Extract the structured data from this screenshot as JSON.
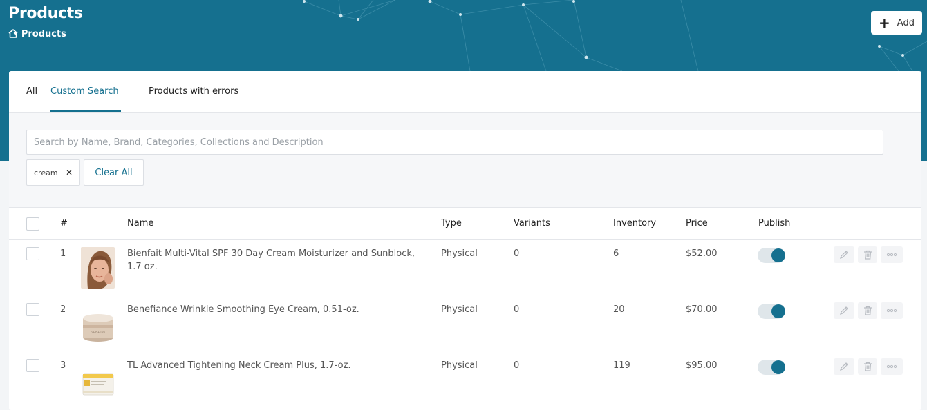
{
  "header": {
    "title": "Products",
    "breadcrumb": "• Products",
    "add_label": "Add",
    "brand_color": "#15708f"
  },
  "tabs": [
    {
      "label": "All",
      "active": false
    },
    {
      "label": "Custom Search",
      "active": true
    },
    {
      "label": "Products with errors",
      "active": false
    }
  ],
  "search": {
    "placeholder": "Search by Name, Brand, Categories, Collections and Description",
    "value": ""
  },
  "filters": {
    "chips": [
      "cream"
    ],
    "clear_all_label": "Clear All"
  },
  "table": {
    "columns": {
      "index": "#",
      "name": "Name",
      "type": "Type",
      "variants": "Variants",
      "inventory": "Inventory",
      "price": "Price",
      "publish": "Publish"
    },
    "rows": [
      {
        "index": "1",
        "name": "Bienfait Multi-Vital SPF 30 Day Cream Moisturizer and Sunblock, 1.7 oz.",
        "type": "Physical",
        "variants": "0",
        "inventory": "6",
        "price": "$52.00",
        "published": true
      },
      {
        "index": "2",
        "name": "Benefiance Wrinkle Smoothing Eye Cream, 0.51-oz.",
        "type": "Physical",
        "variants": "0",
        "inventory": "20",
        "price": "$70.00",
        "published": true
      },
      {
        "index": "3",
        "name": "TL Advanced Tightening Neck Cream Plus, 1.7-oz.",
        "type": "Physical",
        "variants": "0",
        "inventory": "119",
        "price": "$95.00",
        "published": true
      }
    ]
  },
  "icons": {
    "breadcrumb": "home-icon",
    "add": "plus-icon",
    "chip_remove": "close-icon",
    "row_actions": [
      "pencil-icon",
      "trash-icon",
      "more-icon"
    ]
  }
}
